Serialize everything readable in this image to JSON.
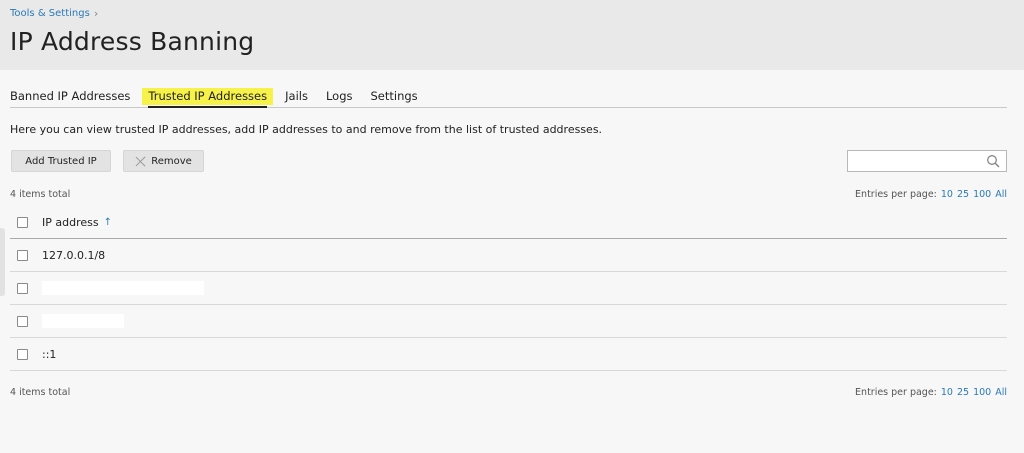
{
  "breadcrumb": {
    "label": "Tools & Settings",
    "chevron": "›"
  },
  "page_title": "IP Address Banning",
  "tabs": [
    {
      "label": "Banned IP Addresses"
    },
    {
      "label": "Trusted IP Addresses"
    },
    {
      "label": "Jails"
    },
    {
      "label": "Logs"
    },
    {
      "label": "Settings"
    }
  ],
  "active_tab_highlight": "#f6f24a",
  "description": "Here you can view trusted IP addresses, add IP addresses to and remove from the list of trusted addresses.",
  "toolbar": {
    "add_label": "Add Trusted IP",
    "remove_label": "Remove"
  },
  "search": {
    "value": ""
  },
  "list": {
    "count_top": "4 items total",
    "count_bottom": "4 items total",
    "entries_label": "Entries per page:",
    "entries_options": [
      "10",
      "25",
      "100",
      "All"
    ]
  },
  "table": {
    "header": "IP address",
    "sort_glyph": "↑",
    "rows": [
      "127.0.0.1/8",
      "",
      "",
      "::1"
    ]
  }
}
